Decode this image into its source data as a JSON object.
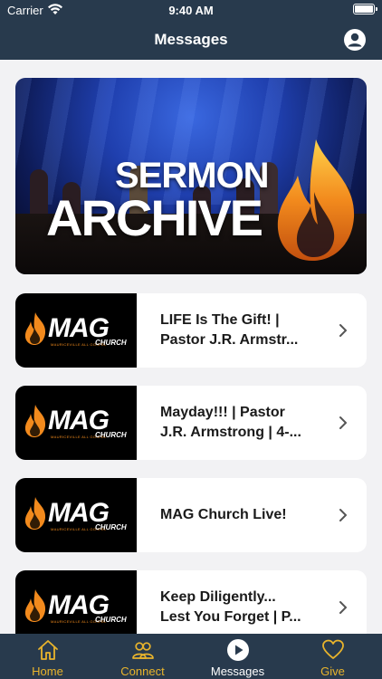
{
  "status": {
    "carrier": "Carrier",
    "time": "9:40 AM"
  },
  "header": {
    "title": "Messages"
  },
  "hero": {
    "line1": "SERMON",
    "line2": "ARCHIVE"
  },
  "thumb": {
    "brand": "MAG",
    "tagline": "MAURICEVILLE ALL GOSPEL",
    "church": "CHURCH"
  },
  "messages": [
    {
      "title": "LIFE Is The Gift! |\nPastor J.R. Armstr..."
    },
    {
      "title": "Mayday!!! | Pastor\nJ.R. Armstrong | 4-..."
    },
    {
      "title": "MAG Church Live!"
    },
    {
      "title": "Keep Diligently...\nLest You Forget | P..."
    }
  ],
  "tabs": [
    {
      "label": "Home"
    },
    {
      "label": "Connect"
    },
    {
      "label": "Messages"
    },
    {
      "label": "Give"
    }
  ],
  "colors": {
    "bar": "#283a4d",
    "accent": "#e9b42c",
    "background": "#f2f2f4"
  }
}
